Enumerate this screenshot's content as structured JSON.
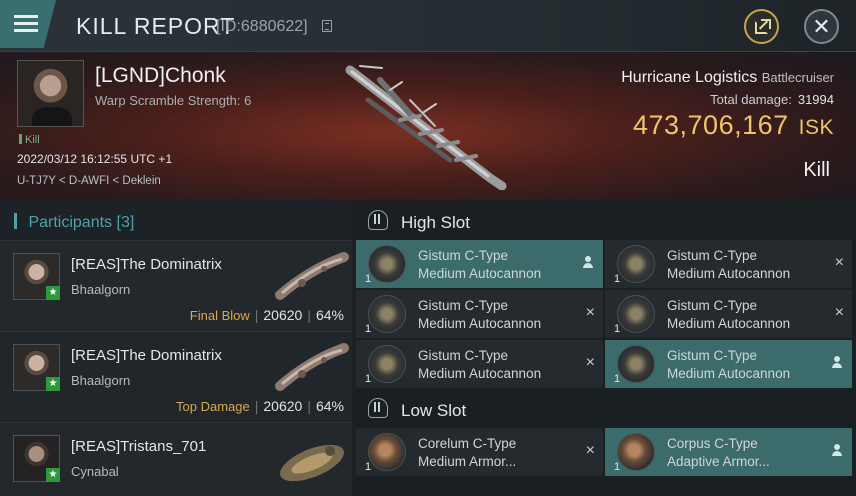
{
  "header": {
    "title": "KILL REPORT",
    "report_id": "[ID:6880622]"
  },
  "victim": {
    "name": "[LGND]Chonk",
    "subtitle": "Warp Scramble Strength: 6",
    "tag": "Kill",
    "datetime": "2022/03/12 16:12:55 UTC +1",
    "location": "U-TJ7Y < D-AWFI < Deklein",
    "ship_name": "Hurricane Logistics",
    "ship_class": "Battlecruiser",
    "total_damage_label": "Total damage:",
    "total_damage": "31994",
    "isk_value": "473,706,167",
    "isk_unit": "ISK",
    "result": "Kill"
  },
  "participants": {
    "label": "Participants",
    "count": "[3]",
    "rows": [
      {
        "name": "[REAS]The Dominatrix",
        "ship": "Bhaalgorn",
        "tag": "Final Blow",
        "damage": "20620",
        "percent": "64%"
      },
      {
        "name": "[REAS]The Dominatrix",
        "ship": "Bhaalgorn",
        "tag": "Top Damage",
        "damage": "20620",
        "percent": "64%"
      },
      {
        "name": "[REAS]Tristans_701",
        "ship": "Cynabal",
        "tag": "",
        "damage": "",
        "percent": ""
      }
    ]
  },
  "fitting": {
    "high_slot_label": "High Slot",
    "low_slot_label": "Low Slot",
    "high_slot": [
      {
        "qty": "1",
        "line1": "Gistum C-Type",
        "line2": "Medium Autocannon",
        "state": "dropped"
      },
      {
        "qty": "1",
        "line1": "Gistum C-Type",
        "line2": "Medium Autocannon",
        "state": "destroyed"
      },
      {
        "qty": "1",
        "line1": "Gistum C-Type",
        "line2": "Medium Autocannon",
        "state": "destroyed"
      },
      {
        "qty": "1",
        "line1": "Gistum C-Type",
        "line2": "Medium Autocannon",
        "state": "destroyed"
      },
      {
        "qty": "1",
        "line1": "Gistum C-Type",
        "line2": "Medium Autocannon",
        "state": "destroyed"
      },
      {
        "qty": "1",
        "line1": "Gistum C-Type",
        "line2": "Medium Autocannon",
        "state": "dropped"
      }
    ],
    "low_slot": [
      {
        "qty": "1",
        "line1": "Corelum C-Type",
        "line2": "Medium Armor...",
        "state": "destroyed"
      },
      {
        "qty": "1",
        "line1": "Corpus C-Type",
        "line2": "Adaptive Armor...",
        "state": "dropped"
      }
    ]
  },
  "icons": {
    "menu": "hamburger-menu-icon",
    "share": "external-share-icon",
    "close": "close-icon",
    "destroyed": "×",
    "dropped": "pilot-icon"
  },
  "colors": {
    "accent": "#4fa3a8",
    "isk": "#f0c46a",
    "dropped_highlight": "#3b6b6a",
    "tag": "#d8a94c"
  }
}
